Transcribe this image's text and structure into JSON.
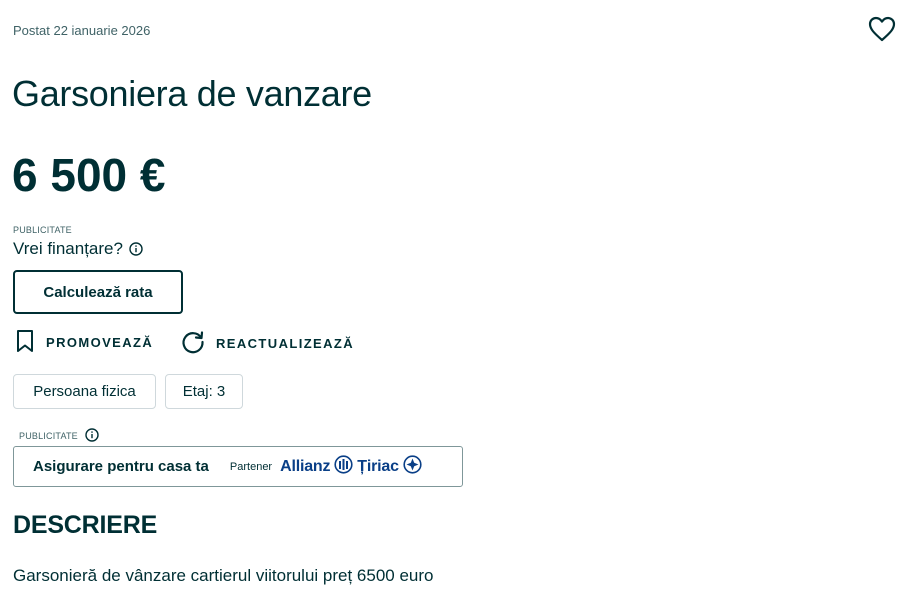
{
  "listing": {
    "posted": "Postat 22 ianuarie 2026",
    "title": "Garsoniera de vanzare",
    "price": "6 500 €"
  },
  "financing": {
    "ad_label": "PUBLICITATE",
    "question": "Vrei finanțare?",
    "button_label": "Calculează rata"
  },
  "actions": {
    "promote_label": "PROMOVEAZĂ",
    "refresh_label": "REACTUALIZEAZĂ"
  },
  "tags": [
    "Persoana fizica",
    "Etaj: 3"
  ],
  "insurance": {
    "ad_label": "PUBLICITATE",
    "text": "Asigurare pentru casa ta",
    "partner_label": "Partener",
    "brand_word1": "Allianz",
    "brand_word2": "Țiriac",
    "brand_color": "#0a3f87"
  },
  "description": {
    "heading": "DESCRIERE",
    "text": "Garsonieră de vânzare cartierul viitorului preț 6500 euro"
  },
  "icons": {
    "favorite": "heart-icon",
    "info": "info-icon",
    "promote": "bookmark-icon",
    "refresh": "refresh-icon"
  },
  "colors": {
    "text": "#002f34",
    "muted": "#406367",
    "border": "#cfd8dc"
  }
}
